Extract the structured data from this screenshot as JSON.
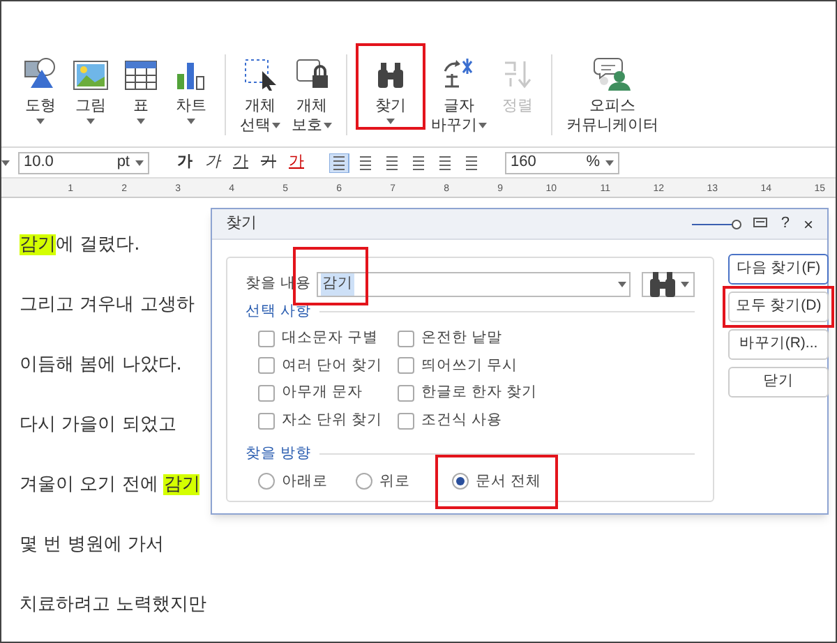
{
  "ribbon": {
    "groups": [
      {
        "tools": [
          {
            "label": "도형",
            "kind": "shape",
            "dropdown": true
          },
          {
            "label": "그림",
            "kind": "picture",
            "dropdown": true
          },
          {
            "label": "표",
            "kind": "table",
            "dropdown": true
          },
          {
            "label": "차트",
            "kind": "chart",
            "dropdown": true
          }
        ]
      },
      {
        "tools": [
          {
            "label": "개체\n선택",
            "kind": "select",
            "dropdown": true
          },
          {
            "label": "개체\n보호",
            "kind": "lock",
            "dropdown": true
          }
        ]
      },
      {
        "tools": [
          {
            "label": "찾기",
            "kind": "binoculars",
            "dropdown": true,
            "highlighted": true
          },
          {
            "label": "글자\n바꾸기",
            "kind": "convert",
            "dropdown": true
          },
          {
            "label": "정렬",
            "kind": "sort",
            "disabled": true
          }
        ]
      },
      {
        "tools": [
          {
            "label": "오피스\n커뮤니케이터",
            "kind": "person"
          }
        ]
      }
    ]
  },
  "format_bar": {
    "font_size": "10.0",
    "unit": "pt",
    "styles": [
      "가",
      "가",
      "가",
      "가",
      "가"
    ],
    "zoom": "160",
    "zoom_unit": "%"
  },
  "ruler": [
    "1",
    "2",
    "3",
    "4",
    "5",
    "6",
    "7",
    "8",
    "9",
    "10",
    "11",
    "12",
    "13",
    "14",
    "15"
  ],
  "document": {
    "lines": [
      [
        {
          "text": "감기",
          "match": true
        },
        {
          "text": "에 걸렸다.",
          "match": false
        }
      ],
      [
        {
          "text": "그리고 겨우내 고생하",
          "match": false
        }
      ],
      [
        {
          "text": "이듬해 봄에 나았다.",
          "match": false
        }
      ],
      [
        {
          "text": "다시 가을이 되었고",
          "match": false
        }
      ],
      [
        {
          "text": "겨울이 오기 전에 ",
          "match": false
        },
        {
          "text": "감기",
          "match": true
        }
      ],
      [
        {
          "text": "몇 번 병원에 가서",
          "match": false
        }
      ],
      [
        {
          "text": "치료하려고 노력했지만",
          "match": false
        }
      ]
    ]
  },
  "dialog": {
    "title": "찾기",
    "find_label": "찾을 내용",
    "find_value": "감기",
    "options_title": "선택 사항",
    "options": [
      {
        "label": "대소문자 구별",
        "checked": false
      },
      {
        "label": "온전한 낱말",
        "checked": false
      },
      {
        "label": "여러 단어 찾기",
        "checked": false
      },
      {
        "label": "띄어쓰기 무시",
        "checked": false
      },
      {
        "label": "아무개 문자",
        "checked": false
      },
      {
        "label": "한글로 한자 찾기",
        "checked": false
      },
      {
        "label": "자소 단위 찾기",
        "checked": false
      },
      {
        "label": "조건식 사용",
        "checked": false
      }
    ],
    "direction_title": "찾을 방향",
    "directions": [
      {
        "label": "아래로",
        "selected": false
      },
      {
        "label": "위로",
        "selected": false
      },
      {
        "label": "문서 전체",
        "selected": true,
        "highlighted": true
      }
    ],
    "buttons": [
      {
        "label": "다음 찾기(F)",
        "default": true,
        "highlighted": false
      },
      {
        "label": "모두 찾기(D)",
        "default": false,
        "highlighted": true
      },
      {
        "label": "바꾸기(R)...",
        "default": false,
        "highlighted": false
      },
      {
        "label": "닫기",
        "default": false,
        "highlighted": false
      }
    ],
    "help": "?",
    "close": "×"
  }
}
